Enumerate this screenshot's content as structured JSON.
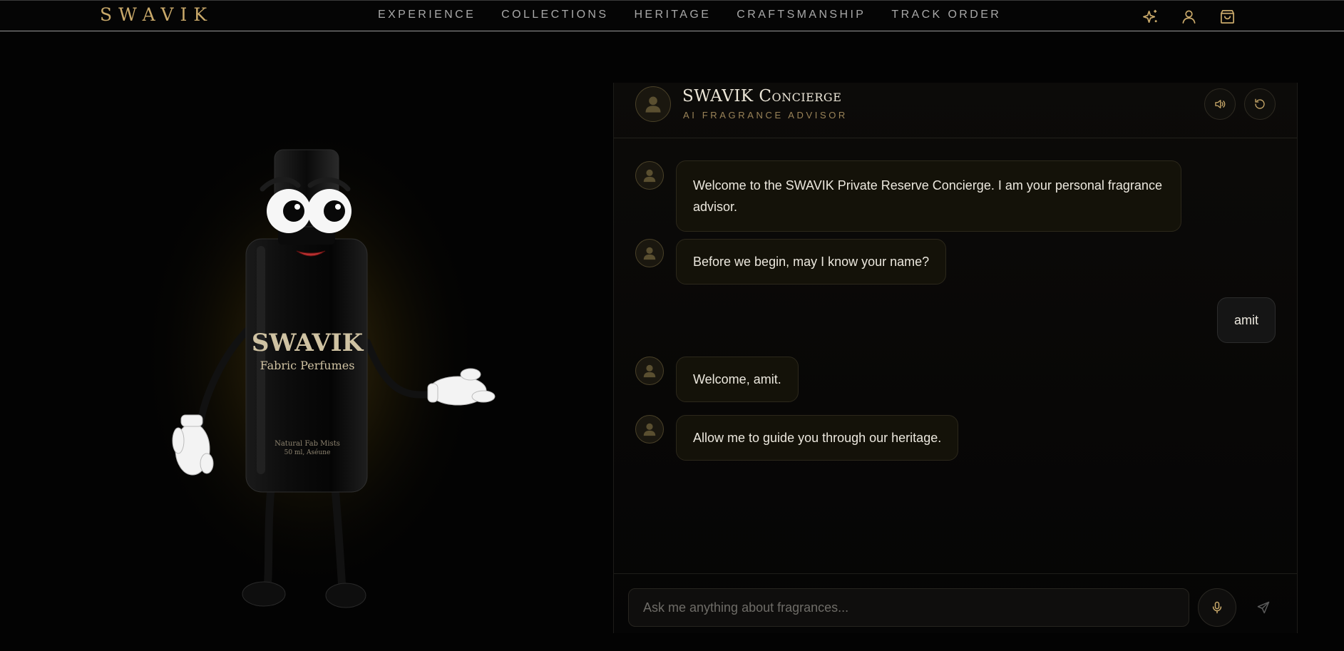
{
  "brand": {
    "logo": "SWAVIK"
  },
  "nav": {
    "links": [
      "EXPERIENCE",
      "COLLECTIONS",
      "HERITAGE",
      "CRAFTSMANSHIP",
      "TRACK ORDER"
    ],
    "icons": [
      "sparkles-icon",
      "user-icon",
      "shopping-bag-icon"
    ]
  },
  "mascot": {
    "label_brand": "SWAVIK",
    "label_sub": "Fabric Perfumes",
    "label_small_1": "Natural Fab Mists",
    "label_small_2": "50 ml, Aséune"
  },
  "chat": {
    "title": "SWAVIK Concierge",
    "subtitle": "AI FRAGRANCE ADVISOR",
    "messages": [
      {
        "role": "assistant",
        "text": "Welcome to the SWAVIK Private Reserve Concierge. I am your personal fragrance advisor."
      },
      {
        "role": "assistant",
        "text": "Before we begin, may I know your name?"
      },
      {
        "role": "user",
        "text": "amit"
      },
      {
        "role": "assistant",
        "text": "Welcome, amit."
      },
      {
        "role": "assistant",
        "text": "Allow me to guide you through our heritage."
      }
    ],
    "input_placeholder": "Ask me anything about fragrances...",
    "input_value": ""
  },
  "colors": {
    "accent_gold": "#c9a96a",
    "background": "#030303",
    "bubble_assistant": "#141209",
    "bubble_user": "#151515"
  }
}
